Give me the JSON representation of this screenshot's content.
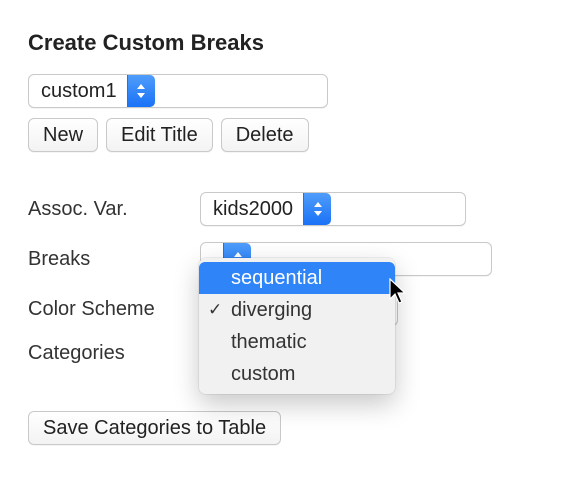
{
  "title": "Create Custom Breaks",
  "name_select": {
    "value": "custom1"
  },
  "buttons": {
    "new": "New",
    "edit_title": "Edit Title",
    "delete": "Delete",
    "save_table": "Save Categories to Table"
  },
  "labels": {
    "assoc_var": "Assoc. Var.",
    "breaks": "Breaks",
    "color_scheme": "Color Scheme",
    "categories": "Categories"
  },
  "assoc_var": {
    "value": "kids2000"
  },
  "breaks": {
    "options": [
      "sequential",
      "diverging",
      "thematic",
      "custom"
    ],
    "highlighted": "sequential",
    "current": "diverging"
  }
}
